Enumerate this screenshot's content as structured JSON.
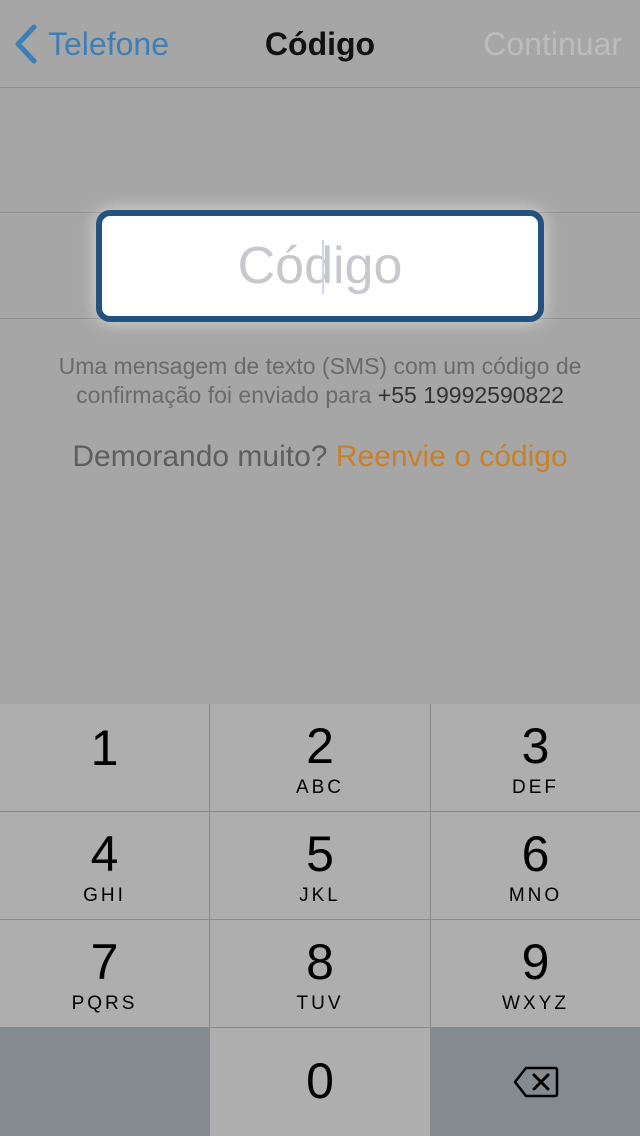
{
  "navbar": {
    "back_label": "Telefone",
    "title": "Código",
    "continue_label": "Continuar"
  },
  "code_field": {
    "placeholder": "Código",
    "value": ""
  },
  "info": {
    "message": "Uma mensagem de texto (SMS) com um código de confirmação foi enviado para",
    "phone": "+55 19992590822"
  },
  "resend": {
    "prompt": "Demorando muito?",
    "link": "Reenvie o código"
  },
  "keypad": {
    "keys": [
      {
        "num": "1",
        "letters": ""
      },
      {
        "num": "2",
        "letters": "ABC"
      },
      {
        "num": "3",
        "letters": "DEF"
      },
      {
        "num": "4",
        "letters": "GHI"
      },
      {
        "num": "5",
        "letters": "JKL"
      },
      {
        "num": "6",
        "letters": "MNO"
      },
      {
        "num": "7",
        "letters": "PQRS"
      },
      {
        "num": "8",
        "letters": "TUV"
      },
      {
        "num": "9",
        "letters": "WXYZ"
      },
      {
        "num": "0",
        "letters": ""
      }
    ],
    "delete_icon": "backspace-icon"
  },
  "colors": {
    "accent_blue": "#3d80b8",
    "link_orange": "#c8802a",
    "field_border": "#24527e"
  }
}
